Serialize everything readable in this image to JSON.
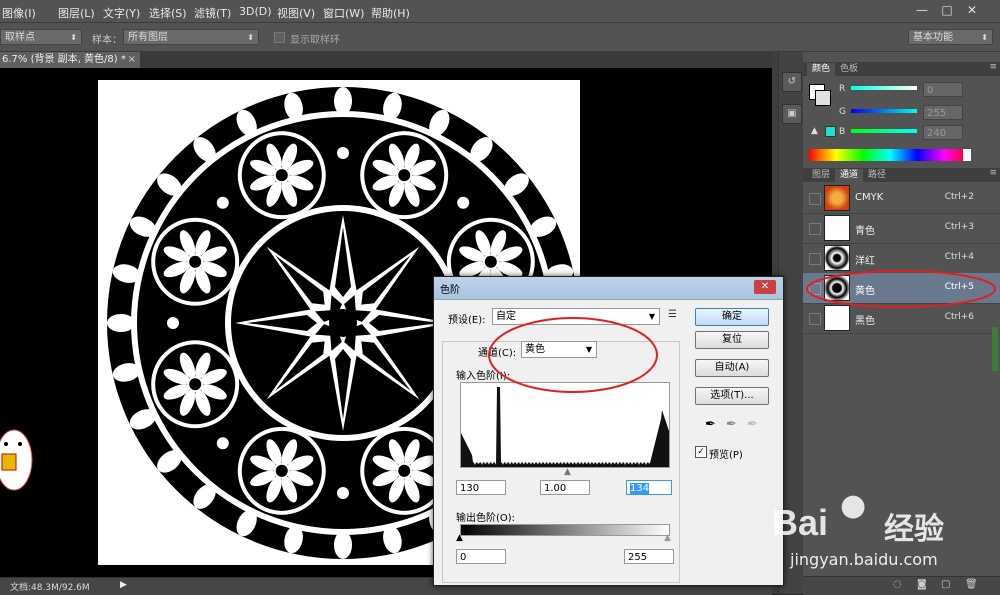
{
  "menubar": {
    "items": [
      "图像(I)",
      "图层(L)",
      "文字(Y)",
      "选择(S)",
      "滤镜(T)",
      "3D(D)",
      "视图(V)",
      "窗口(W)",
      "帮助(H)"
    ],
    "window_controls": [
      "—",
      "□",
      "✕"
    ]
  },
  "options": {
    "sample_label": "取样点",
    "sample_prefix": "样本：",
    "sample_value": "所有图层",
    "ring_label": "显示取样环",
    "workspace": "基本功能"
  },
  "document": {
    "tab_title": "6.7% (背景 副本, 黄色/8) *",
    "status": "文档:48.3M/92.6M"
  },
  "color_panel": {
    "tabs": [
      "颜色",
      "色板"
    ],
    "channels": [
      {
        "label": "R",
        "value": "0"
      },
      {
        "label": "G",
        "value": "255"
      },
      {
        "label": "B",
        "value": "240"
      }
    ]
  },
  "channels_panel": {
    "tabs": [
      "图层",
      "通道",
      "路径"
    ],
    "rows": [
      {
        "name": "CMYK",
        "shortcut": "Ctrl+2"
      },
      {
        "name": "青色",
        "shortcut": "Ctrl+3"
      },
      {
        "name": "洋红",
        "shortcut": "Ctrl+4"
      },
      {
        "name": "黄色",
        "shortcut": "Ctrl+5"
      },
      {
        "name": "黑色",
        "shortcut": "Ctrl+6"
      }
    ]
  },
  "levels_dialog": {
    "title": "色阶",
    "preset_label": "预设(E):",
    "preset_value": "自定",
    "channel_label": "通道(C):",
    "channel_value": "黄色",
    "input_label": "输入色阶(I):",
    "input_black": "130",
    "input_gamma": "1.00",
    "input_white": "134",
    "output_label": "输出色阶(O):",
    "output_black": "0",
    "output_white": "255",
    "buttons": {
      "ok": "确定",
      "reset": "复位",
      "auto": "自动(A)",
      "options": "选项(T)..."
    },
    "preview_label": "预览(P)",
    "preview_checked": true
  },
  "watermark": {
    "brand": "Bai",
    "brand_cn": "经验",
    "url": "jingyan.baidu.com"
  },
  "colors": {
    "accent_highlight": "#3399ff",
    "annotation": "#e02020"
  }
}
